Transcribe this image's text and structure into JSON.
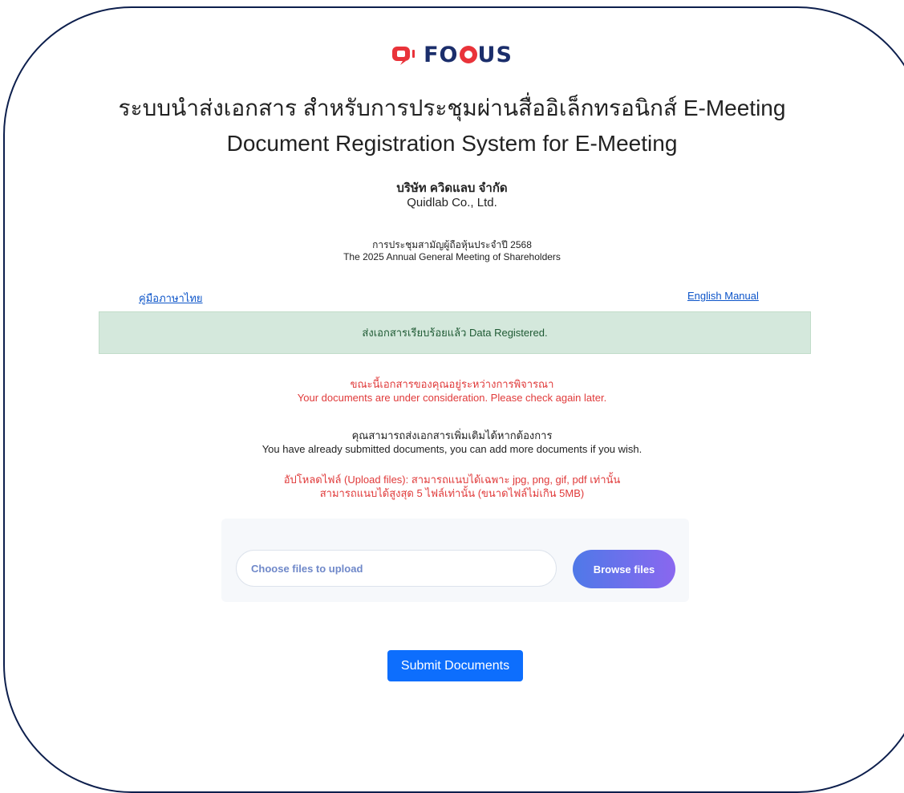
{
  "header": {
    "logo_text_1": "FO",
    "logo_text_2": "US",
    "title_th": "ระบบนำส่งเอกสาร สำหรับการประชุมผ่านสื่ออิเล็กทรอนิกส์ E-Meeting",
    "title_en": "Document Registration System for E-Meeting"
  },
  "company": {
    "name_th": "บริษัท ควิดแลบ จำกัด",
    "name_en": "Quidlab Co., Ltd."
  },
  "meeting": {
    "name_th": "การประชุมสามัญผู้ถือหุ้นประจำปี 2568",
    "name_en": "The 2025 Annual General Meeting of Shareholders"
  },
  "links": {
    "manual_th": "คู่มือภาษาไทย",
    "manual_en": "English Manual"
  },
  "alert": {
    "text": "ส่งเอกสารเรียบร้อยแล้ว Data Registered."
  },
  "status": {
    "line_th": "ขณะนี้เอกสารของคุณอยู่ระหว่างการพิจารณา",
    "line_en": "Your documents are under consideration. Please check again later."
  },
  "info": {
    "line_th": "คุณสามารถส่งเอกสารเพิ่มเติมได้หากต้องการ",
    "line_en": "You have already submitted documents, you can add more documents if you wish."
  },
  "upload_note": {
    "line_1": "อัปโหลดไฟล์ (Upload files): สามารถแนบได้เฉพาะ jpg, png, gif, pdf เท่านั้น",
    "line_2": "สามารถแนบได้สูงสุด 5 ไฟล์เท่านั้น (ขนาดไฟล์ไม่เกิน 5MB)"
  },
  "upload": {
    "placeholder": "Choose files to upload",
    "browse_label": "Browse files"
  },
  "submit_label": "Submit Documents",
  "colors": {
    "brand_red": "#e9333a",
    "brand_navy": "#1b2e6b",
    "alert_bg": "#d4e8dc",
    "primary": "#0d6efd"
  }
}
